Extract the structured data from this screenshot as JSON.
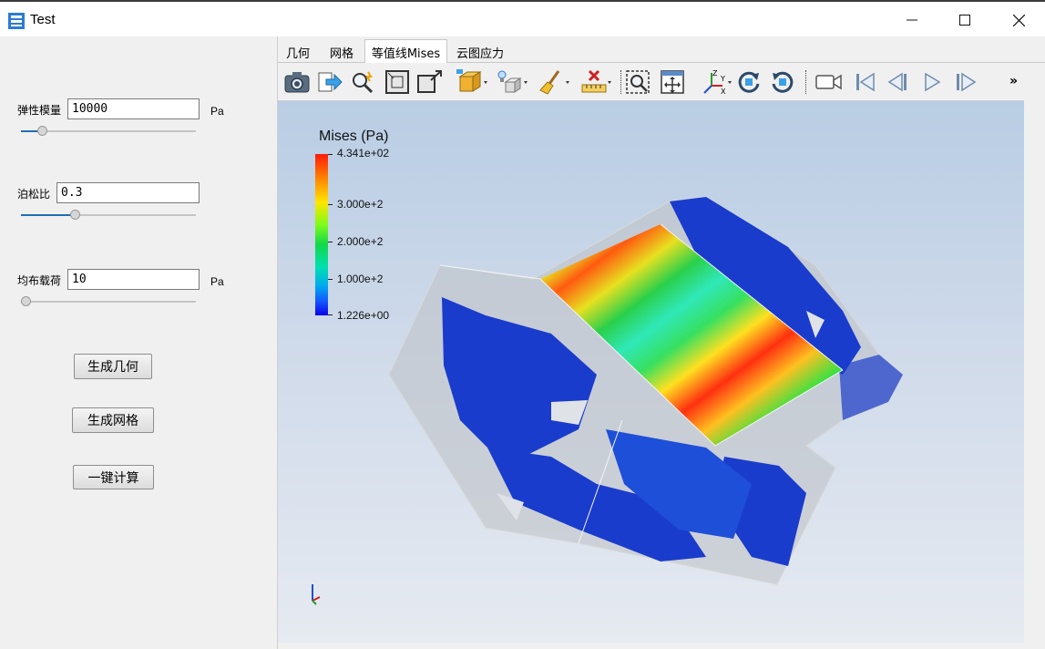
{
  "window": {
    "title": "Test"
  },
  "left_panel": {
    "params": [
      {
        "label": "弹性模量",
        "value": "10000",
        "unit": "Pa",
        "slider_fraction": 0.1
      },
      {
        "label": "泊松比",
        "value": "0.3",
        "unit": "",
        "slider_fraction": 0.3
      },
      {
        "label": "均布载荷",
        "value": "10",
        "unit": "Pa",
        "slider_fraction": 0.0
      }
    ],
    "buttons": {
      "generate_geometry": "生成几何",
      "generate_mesh": "生成网格",
      "one_click_compute": "一键计算"
    }
  },
  "tabs": [
    {
      "label": "几何",
      "active": false
    },
    {
      "label": "网格",
      "active": false
    },
    {
      "label": "等值线Mises",
      "active": true
    },
    {
      "label": "云图应力",
      "active": false
    }
  ],
  "toolbar": {
    "more": "»"
  },
  "legend": {
    "title": "Mises (Pa)",
    "labels": [
      "4.341e+02",
      "3.000e+2",
      "2.000e+2",
      "1.000e+2",
      "1.226e+00"
    ]
  }
}
